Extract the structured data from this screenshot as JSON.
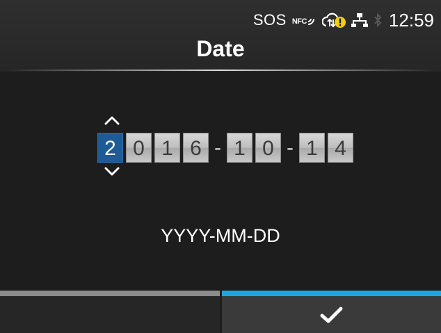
{
  "status_bar": {
    "sos": "SOS",
    "nfc": "NFC",
    "time": "12:59"
  },
  "title": "Date",
  "date": {
    "year": [
      "2",
      "0",
      "1",
      "6"
    ],
    "month": [
      "1",
      "0"
    ],
    "day": [
      "1",
      "4"
    ],
    "separator": "-",
    "selected_digit": "year-1"
  },
  "format_label": "YYYY-MM-DD",
  "colors": {
    "accent": "#19a7e3",
    "selected_digit": "#1d5a96",
    "left_bar": "#8c8c8c"
  },
  "icons": {
    "up": "chevron-up-icon",
    "down": "chevron-down-icon",
    "confirm": "checkmark-icon"
  }
}
